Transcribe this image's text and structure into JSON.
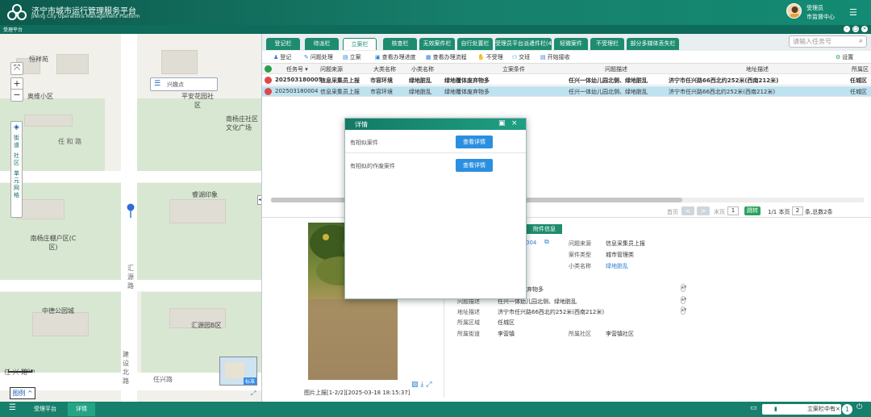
{
  "header": {
    "title": "济宁市城市运行管理服务平台",
    "subtitle": "JiNing City Operations Management Platform",
    "user_name": "受理员",
    "user_org": "市监督中心"
  },
  "subbar": {
    "label": "受理平台"
  },
  "map": {
    "search_label": "兴趣点",
    "side_tools": [
      "街道",
      "社区",
      "单元网格"
    ],
    "places": [
      "恒祥苑",
      "奥维小区",
      "平安花园社区",
      "南杨庄社区文化广场",
      "任 和 路",
      "睿湖印象",
      "南杨庄棚户区(C区)",
      "中德公园城",
      "汇源园B区",
      "任 兴 路",
      "汇 源 路",
      "建 设 北 路",
      "任兴路"
    ],
    "scale": "100m",
    "minimap_label": "标准",
    "legend_label": "图例"
  },
  "tabs": [
    {
      "label": "登记栏"
    },
    {
      "label": "待派栏"
    },
    {
      "label": "立案栏",
      "active": true
    },
    {
      "label": "核查栏"
    },
    {
      "label": "无效案件栏"
    },
    {
      "label": "自行处置栏"
    },
    {
      "label": "受理员平台派遣件栏(4)"
    },
    {
      "label": "轻微案件"
    },
    {
      "label": "不受理栏"
    },
    {
      "label": "部分多媒体丢失栏"
    }
  ],
  "search": {
    "placeholder": "请输入任务号"
  },
  "toolbar": {
    "items": [
      "登记",
      "问题处理",
      "立案",
      "查看办理进度",
      "查看办理流程",
      "不受理",
      "交班",
      "开始接收"
    ],
    "settings": "设置"
  },
  "table": {
    "columns": [
      "任务号",
      "问题来源",
      "大类名称",
      "小类名称",
      "立案条件",
      "问题描述",
      "地址描述",
      "所属区"
    ],
    "rows": [
      [
        "202503180005",
        "信息采集员上报",
        "市容环境",
        "绿地脏乱",
        "绿地覆体废弃物多",
        "任兴一体幼儿园北侧、绿地脏乱",
        "济宁市任兴路66西北约252米(西南212米)",
        "任城区"
      ],
      [
        "202503180004",
        "信息采集员上报",
        "市容环境",
        "绿地脏乱",
        "绿地覆体废弃物多",
        "任兴一体幼儿园北侧、绿地脏乱",
        "济宁市任兴路66西北约252米(西南212米)",
        "任城区"
      ]
    ]
  },
  "pager": {
    "first": "首页",
    "prev": "<",
    "next": ">",
    "last": "末页",
    "page": "1",
    "go": "跳转",
    "info_prefix": "1/1 本页",
    "page_size": "2",
    "info_suffix": "条,总数2条"
  },
  "detail": {
    "tab": "附件信息",
    "id_fragment": "004",
    "fields": [
      {
        "label": "问题来源",
        "value": "信息采集员上报"
      },
      {
        "label": "案件类型",
        "value": "城市管理类"
      },
      {
        "label": "小类名称",
        "value": "绿地脏乱"
      }
    ],
    "cond_fragment": "弃物多",
    "desc_label": "问题描述",
    "desc_value": "任兴一体幼儿园北侧、绿地脏乱",
    "addr_label": "地址描述",
    "addr_value": "济宁市任兴路66西北约252米(西南212米)",
    "district_label": "所属区域",
    "district_value": "任城区",
    "street_label": "所属街道",
    "street_value": "李营镇",
    "community_label": "所属社区",
    "community_value": "李营镇社区",
    "photo_caption": "图片上报[1-2/2][2025-03-18 18:15:37]"
  },
  "modal": {
    "title": "详情",
    "rows": [
      {
        "label": "有相似案件",
        "button": "查看详情"
      },
      {
        "label": "有相似的作废案件",
        "button": "查看详情"
      }
    ]
  },
  "taskbar": {
    "tabs": [
      {
        "label": "受理平台"
      },
      {
        "label": "详情",
        "active": true
      }
    ],
    "status": "立案栏中有",
    "count": "1"
  },
  "colors": {
    "primary": "#17806c",
    "tab": "#1d8c6f",
    "selected_row": "#bfe2f1",
    "button": "#2b8fe0"
  }
}
